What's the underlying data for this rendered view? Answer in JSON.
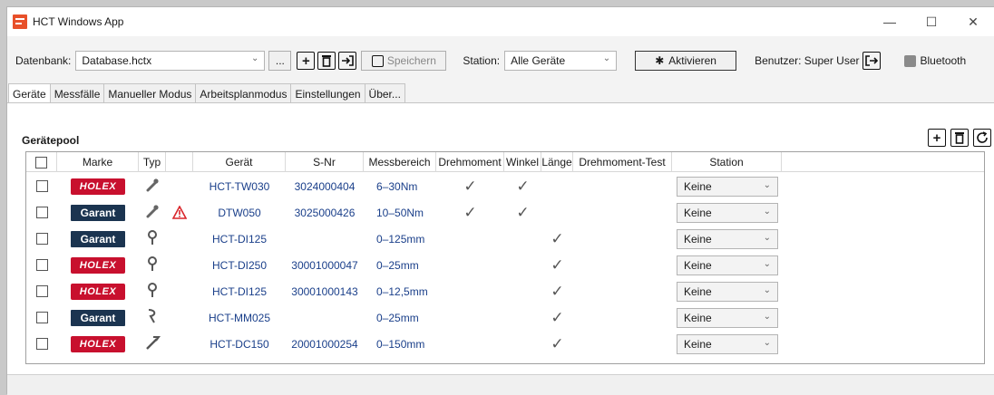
{
  "window": {
    "title": "HCT Windows App",
    "minimize": "—",
    "maximize": "☐",
    "close": "✕"
  },
  "toolbar": {
    "db_label": "Datenbank:",
    "db_value": "Database.hctx",
    "browse": "...",
    "save": "Speichern",
    "station_label": "Station:",
    "station_value": "Alle Geräte",
    "activate": "Aktivieren",
    "user": "Benutzer: Super User",
    "bluetooth": "Bluetooth"
  },
  "tabs": [
    "Geräte",
    "Messfälle",
    "Manueller Modus",
    "Arbeitsplanmodus",
    "Einstellungen",
    "Über..."
  ],
  "pool": {
    "title": "Gerätepool",
    "columns": [
      "Marke",
      "Typ",
      "Gerät",
      "S-Nr",
      "Messbereich",
      "Drehmoment",
      "Winkel",
      "Länge",
      "Drehmoment-Test",
      "Station"
    ],
    "rows": [
      {
        "brand": "HOLEX",
        "type": "torque-wrench-icon",
        "warn": false,
        "device": "HCT-TW030",
        "snr": "3024000404",
        "range": "6–30Nm",
        "drehmoment": true,
        "winkel": true,
        "laenge": false,
        "station": "Keine"
      },
      {
        "brand": "Garant",
        "type": "torque-wrench-icon",
        "warn": true,
        "device": "DTW050",
        "snr": "3025000426",
        "range": "10–50Nm",
        "drehmoment": true,
        "winkel": true,
        "laenge": false,
        "station": "Keine"
      },
      {
        "brand": "Garant",
        "type": "dial-indicator-icon",
        "warn": false,
        "device": "HCT-DI125",
        "snr": "",
        "range": "0–125mm",
        "drehmoment": false,
        "winkel": false,
        "laenge": true,
        "station": "Keine"
      },
      {
        "brand": "HOLEX",
        "type": "dial-indicator-icon",
        "warn": false,
        "device": "HCT-DI250",
        "snr": "30001000047",
        "range": "0–25mm",
        "drehmoment": false,
        "winkel": false,
        "laenge": true,
        "station": "Keine"
      },
      {
        "brand": "HOLEX",
        "type": "dial-indicator-icon",
        "warn": false,
        "device": "HCT-DI125",
        "snr": "30001000143",
        "range": "0–12,5mm",
        "drehmoment": false,
        "winkel": false,
        "laenge": true,
        "station": "Keine"
      },
      {
        "brand": "Garant",
        "type": "micrometer-icon",
        "warn": false,
        "device": "HCT-MM025",
        "snr": "",
        "range": "0–25mm",
        "drehmoment": false,
        "winkel": false,
        "laenge": true,
        "station": "Keine"
      },
      {
        "brand": "HOLEX",
        "type": "caliper-icon",
        "warn": false,
        "device": "HCT-DC150",
        "snr": "20001000254",
        "range": "0–150mm",
        "drehmoment": false,
        "winkel": false,
        "laenge": true,
        "station": "Keine"
      }
    ]
  },
  "colors": {
    "holex": "#c8102e",
    "garant": "#1b3450",
    "link": "#1a3f8a",
    "warning": "#d9262c"
  }
}
